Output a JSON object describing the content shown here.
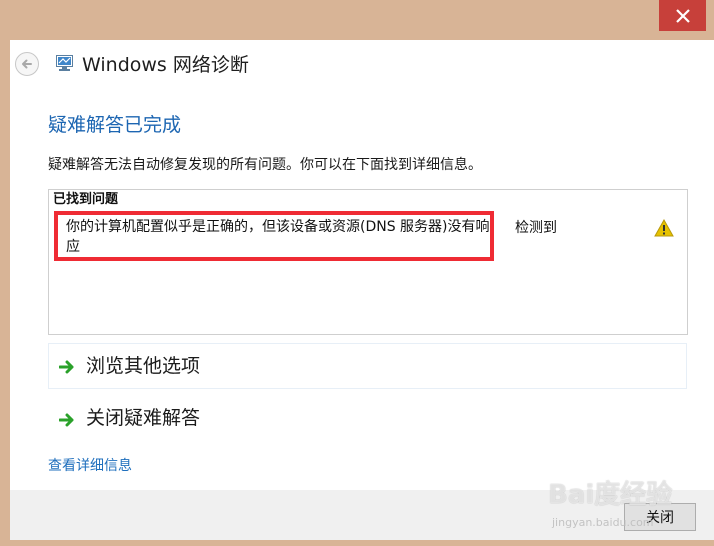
{
  "window": {
    "title": "Windows 网络诊断",
    "close_glyph": "✕"
  },
  "main": {
    "heading": "疑难解答已完成",
    "description": "疑难解答无法自动修复发现的所有问题。你可以在下面找到详细信息。",
    "issues": {
      "title": "已找到问题",
      "items": [
        {
          "text": "你的计算机配置似乎是正确的，但该设备或资源(DNS 服务器)没有响应",
          "status": "检测到",
          "icon": "warning-icon"
        }
      ]
    },
    "options": [
      {
        "label": "浏览其他选项",
        "icon": "green-arrow-icon"
      },
      {
        "label": "关闭疑难解答",
        "icon": "green-arrow-icon"
      }
    ],
    "details_link": "查看详细信息"
  },
  "footer": {
    "close_button": "关闭"
  },
  "watermark": {
    "main": "Bai度经验",
    "sub": "jingyan.baidu.com"
  },
  "colors": {
    "frame": "#d8b496",
    "close_button_bg": "#c7403a",
    "heading": "#1d66b2",
    "highlight": "#ef2b34",
    "link": "#1f6fbd",
    "arrow": "#2aa12a",
    "warning": "#e6c200"
  }
}
